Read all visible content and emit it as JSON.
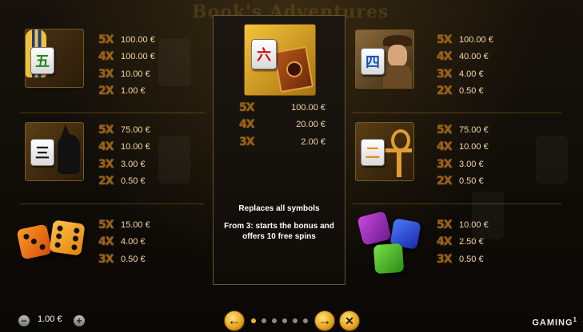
{
  "game_title": "Book's Adventures",
  "left_column": [
    {
      "tile_glyph": "五",
      "tile_color": "#1e8a1e",
      "pays": [
        {
          "mult": "5X",
          "value": "100.00 €"
        },
        {
          "mult": "4X",
          "value": "100.00 €"
        },
        {
          "mult": "3X",
          "value": "10.00 €"
        },
        {
          "mult": "2X",
          "value": "1.00 €"
        }
      ]
    },
    {
      "tile_glyph": "三",
      "tile_color": "#111111",
      "pays": [
        {
          "mult": "5X",
          "value": "75.00 €"
        },
        {
          "mult": "4X",
          "value": "10.00 €"
        },
        {
          "mult": "3X",
          "value": "3.00 €"
        },
        {
          "mult": "2X",
          "value": "0.50 €"
        }
      ]
    },
    {
      "pays": [
        {
          "mult": "5X",
          "value": "15.00 €"
        },
        {
          "mult": "4X",
          "value": "4.00 €"
        },
        {
          "mult": "3X",
          "value": "0.50 €"
        }
      ]
    }
  ],
  "right_column": [
    {
      "tile_glyph": "四",
      "tile_color": "#1a4fb8",
      "pays": [
        {
          "mult": "5X",
          "value": "100.00 €"
        },
        {
          "mult": "4X",
          "value": "40.00 €"
        },
        {
          "mult": "3X",
          "value": "4.00 €"
        },
        {
          "mult": "2X",
          "value": "0.50 €"
        }
      ]
    },
    {
      "tile_glyph": "二",
      "tile_color": "#e08a10",
      "pays": [
        {
          "mult": "5X",
          "value": "75.00 €"
        },
        {
          "mult": "4X",
          "value": "10.00 €"
        },
        {
          "mult": "3X",
          "value": "3.00 €"
        },
        {
          "mult": "2X",
          "value": "0.50 €"
        }
      ]
    },
    {
      "pays": [
        {
          "mult": "5X",
          "value": "10.00 €"
        },
        {
          "mult": "4X",
          "value": "2.50 €"
        },
        {
          "mult": "3X",
          "value": "0.50 €"
        }
      ]
    }
  ],
  "center": {
    "tile_glyph": "六",
    "tile_color": "#cc1010",
    "pays": [
      {
        "mult": "5X",
        "value": "100.00 €"
      },
      {
        "mult": "4X",
        "value": "20.00 €"
      },
      {
        "mult": "3X",
        "value": "2.00 €"
      }
    ],
    "wild_text": "Replaces all symbols",
    "bonus_text": "From 3: starts the bonus and offers 10 free spins"
  },
  "bottom_bar": {
    "bet_value": "1.00 €",
    "minus": "−",
    "plus": "+",
    "prev_icon": "←",
    "next_icon": "→",
    "close_icon": "✕",
    "brand": "GAMING",
    "brand_sup": "1"
  },
  "colors": {
    "multiplier": "#a8650e",
    "value": "#f6d9a3",
    "accent": "#f4b52a"
  }
}
